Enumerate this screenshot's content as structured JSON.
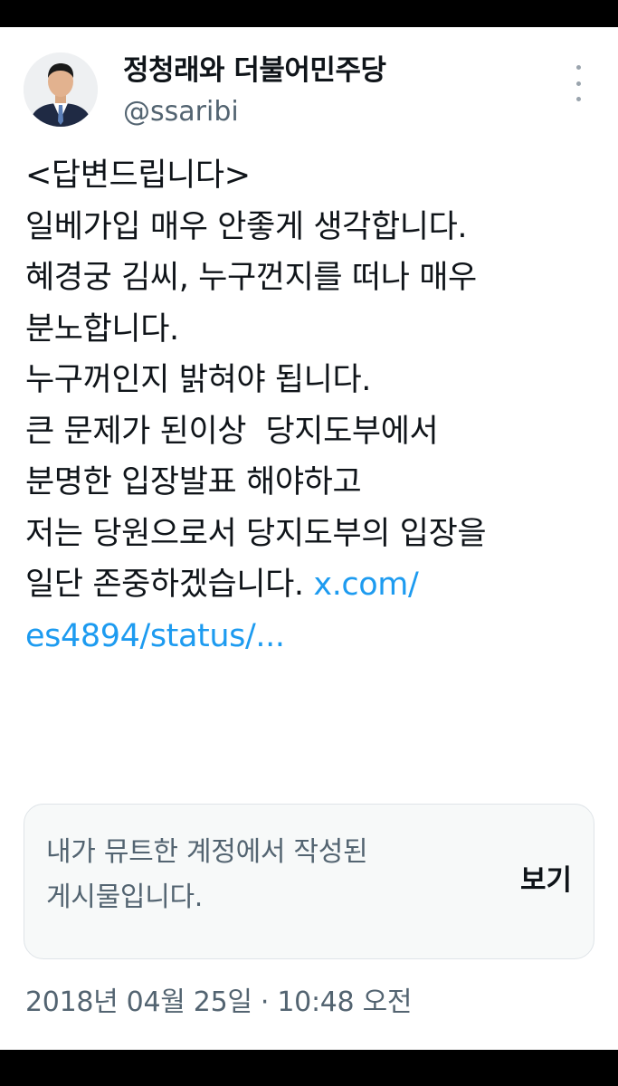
{
  "author": {
    "display_name": "정청래와 더불어민주당",
    "handle": "@ssaribi",
    "avatar_icon": "profile-photo"
  },
  "tweet": {
    "lines": [
      "<답변드립니다>",
      "일베가입 매우 안좋게 생각합니다.",
      "혜경궁 김씨, 누구껀지를 떠나 매우",
      "분노합니다.",
      "누구꺼인지 밝혀야 됩니다.",
      "큰 문제가 된이상  당지도부에서",
      "분명한 입장발표 해야하고",
      "저는 당원으로서 당지도부의 입장을",
      "일단 존중하겠습니다. "
    ],
    "link_line1": "x.com/",
    "link_line2": "es4894/status/..."
  },
  "muted_notice": {
    "text": "내가 뮤트한 계정에서 작성된\n게시물입니다.",
    "view_label": "보기"
  },
  "timestamp": "2018년 04월 25일 · 10:48 오전",
  "colors": {
    "link": "#1d9bf0",
    "secondary_text": "#536471",
    "primary_text": "#0f1419"
  }
}
